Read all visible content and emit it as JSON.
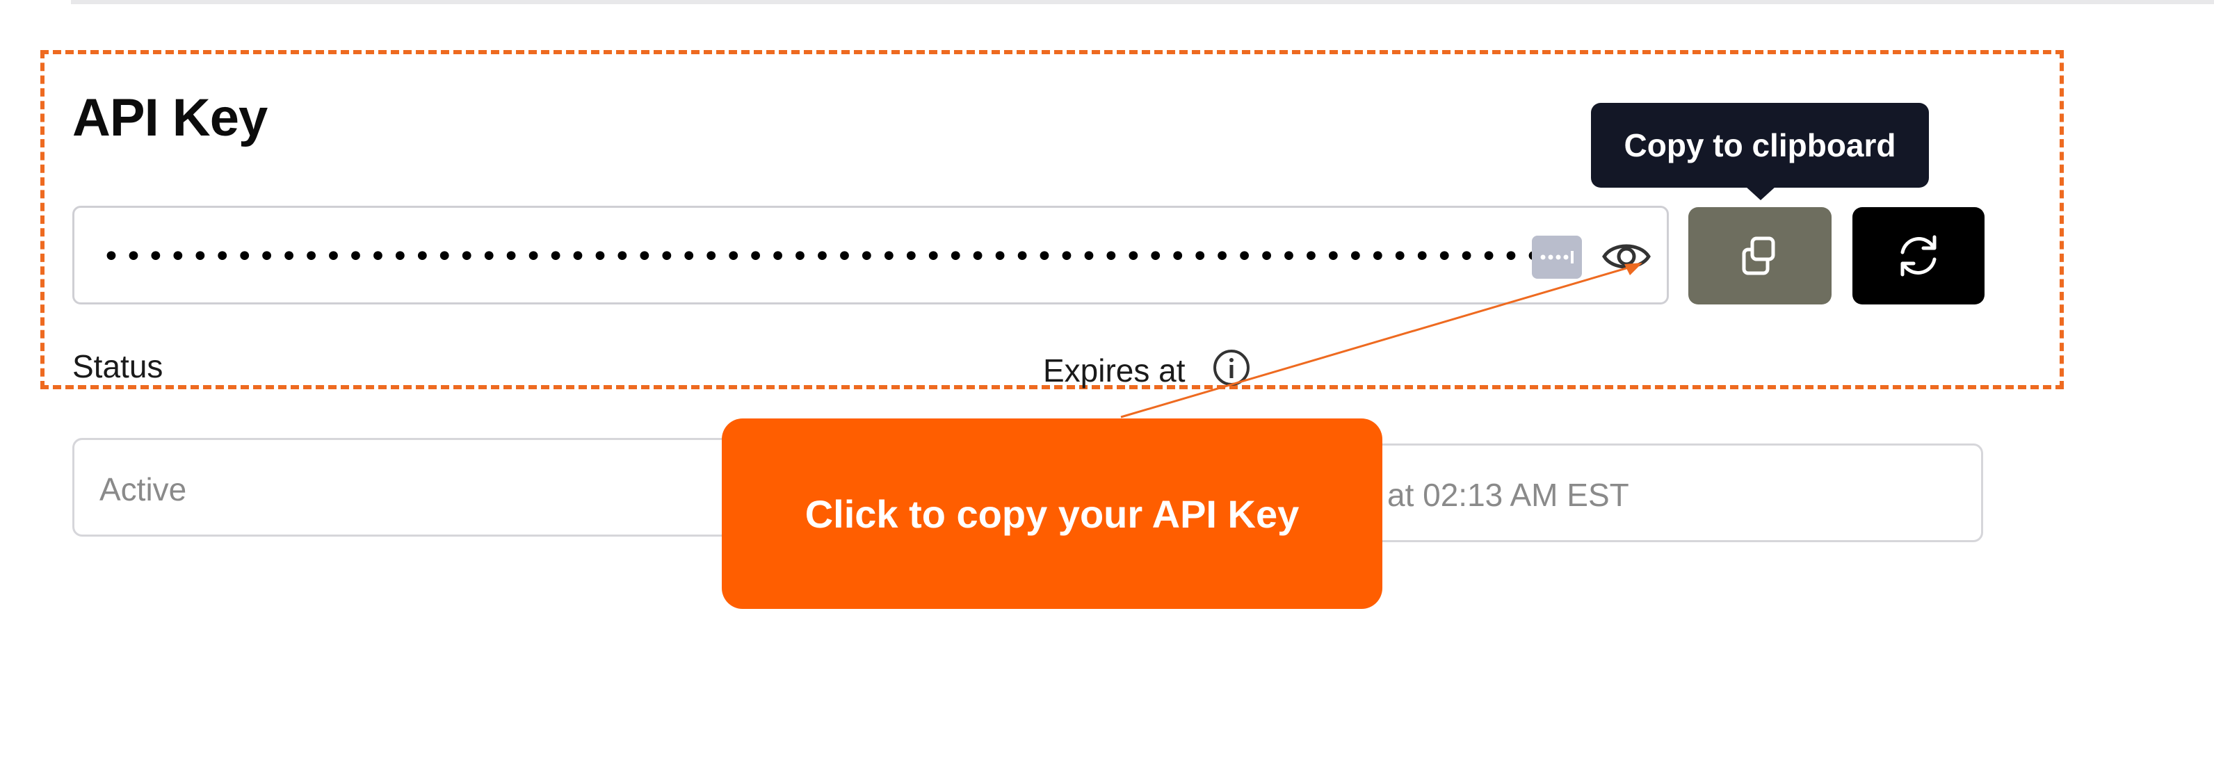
{
  "section": {
    "title": "API Key"
  },
  "api_key": {
    "masked_value": "••••••••••••••••••••••••••••••••••••••••••••••••••••••••••••••••••••••••",
    "password_manager_icon": "password-manager-icon",
    "toggle_visibility_icon": "eye-icon"
  },
  "actions": {
    "copy_icon": "copy-icon",
    "refresh_icon": "refresh-icon",
    "tooltip": "Copy to clipboard"
  },
  "status": {
    "label": "Status",
    "value": "Active"
  },
  "expires": {
    "label": "Expires at",
    "info_icon": "info-icon",
    "value_visible": "at 02:13 AM EST"
  },
  "callout": {
    "text": "Click to copy your API Key"
  },
  "colors": {
    "highlight": "#ee6a20",
    "callout_bg": "#ff5e00",
    "copy_button": "#6e6e5f",
    "refresh_button": "#000000",
    "tooltip_bg": "#131726"
  }
}
